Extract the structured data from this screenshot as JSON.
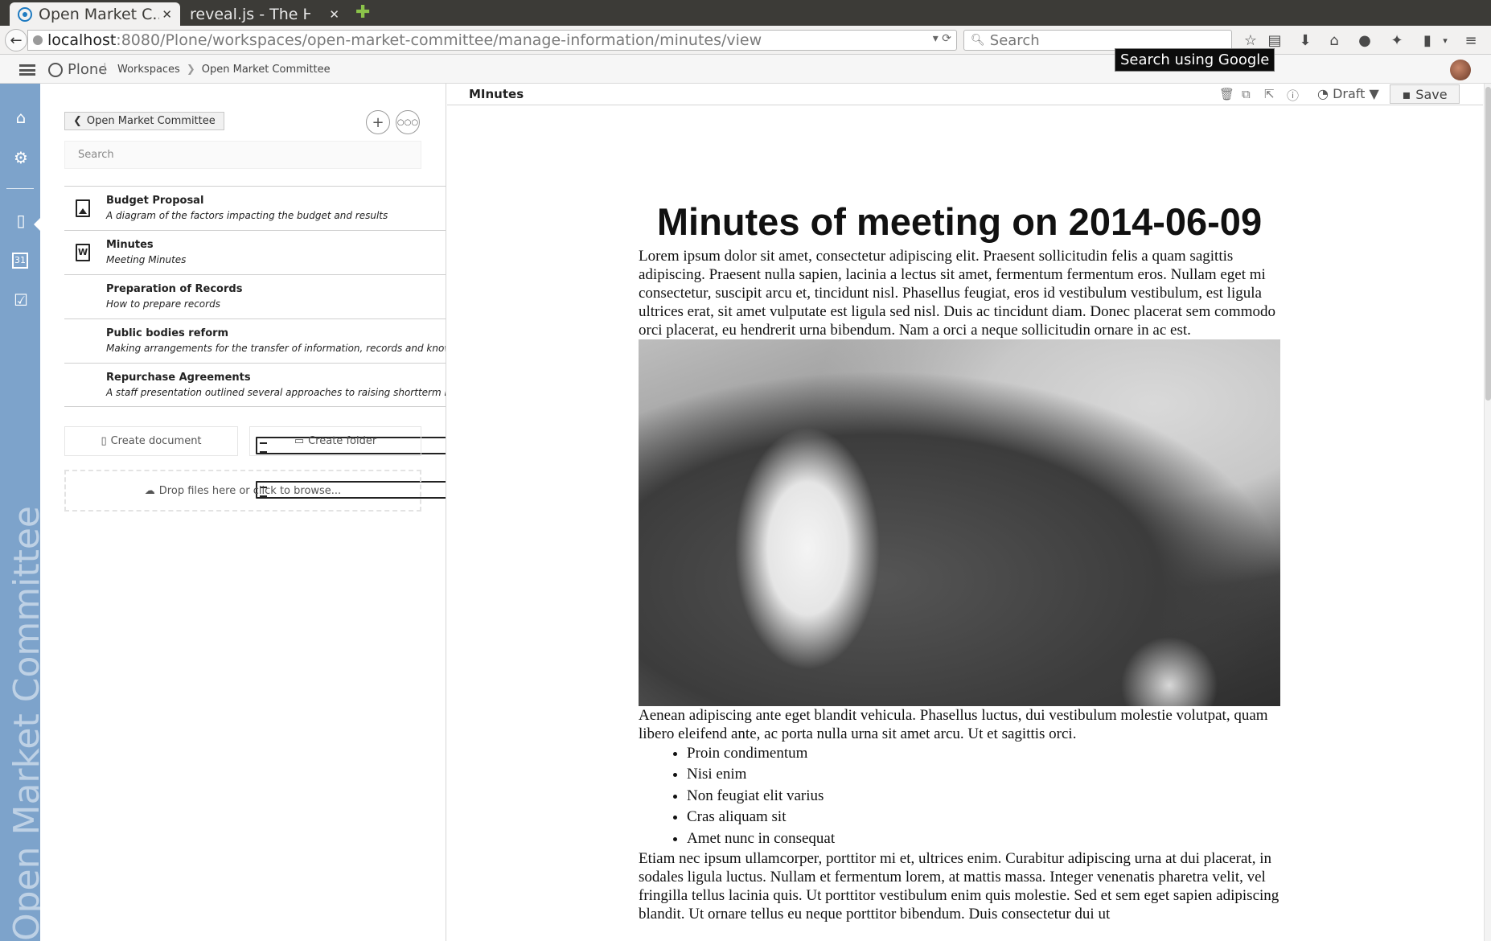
{
  "browser": {
    "tabs": [
      {
        "title": "Open Market C...",
        "active": true
      },
      {
        "title": "reveal.js - The HTM...",
        "active": false
      }
    ],
    "url_host": "localhost",
    "url_path": ":8080/Plone/workspaces/open-market-committee/manage-information/minutes/view",
    "search_placeholder": "Search",
    "tooltip": "Search using Google"
  },
  "toolbar": {
    "logo": "Plone",
    "breadcrumbs": [
      "Workspaces",
      "Open Market Committee"
    ]
  },
  "leftbar": {
    "workspace_title": "Open Market Committee",
    "calendar_day": "31"
  },
  "sidebar": {
    "back_label": "Open Market Committee",
    "search_placeholder": "Search",
    "items": [
      {
        "title": "Budget Proposal",
        "description": "A diagram of the factors impacting the budget and results",
        "icon": "image-file-icon"
      },
      {
        "title": "Minutes",
        "description": "Meeting Minutes",
        "icon": "word-file-icon"
      },
      {
        "title": "Preparation of Records",
        "description": "How to prepare records",
        "icon": ""
      },
      {
        "title": "Public bodies reform",
        "description": "Making arrangements for the transfer of information, records and knowledge",
        "icon": "document-icon"
      },
      {
        "title": "Repurchase Agreements",
        "description": "A staff presentation outlined several approaches to raising shortterm interest rates",
        "icon": "document-icon"
      }
    ],
    "create_document": "Create document",
    "create_folder": "Create folder",
    "dropzone": "Drop files here or click to browse..."
  },
  "main": {
    "title": "MInutes",
    "state": "Draft",
    "save_label": "Save",
    "document": {
      "heading": "Minutes of meeting on 2014-06-09",
      "paragraph1": "Lorem ipsum dolor sit amet, consectetur adipiscing elit. Praesent sollicitudin felis a quam sagittis adipiscing. Praesent nulla sapien, lacinia a lectus sit amet, fermentum fermentum eros. Nullam eget mi consectetur, suscipit arcu et, tincidunt nisl. Phasellus feugiat, eros id vestibulum vestibulum, est ligula ultrices erat, sit amet vulputate est ligula sed nisl. Duis ac tincidunt diam. Donec placerat sem commodo orci placerat, eu hendrerit urna bibendum. Nam a orci a neque sollicitudin ornare in ac est.",
      "paragraph2": "Aenean adipiscing ante eget blandit vehicula. Phasellus luctus, dui vestibulum molestie volutpat, quam libero eleifend ante, ac porta nulla urna sit amet arcu. Ut et sagittis orci.",
      "bullets": [
        "Proin condimentum",
        "Nisi enim",
        "Non feugiat elit varius",
        "Cras aliquam sit",
        "Amet nunc in consequat"
      ],
      "paragraph3": "Etiam nec ipsum ullamcorper, porttitor mi et, ultrices enim. Curabitur adipiscing urna at dui placerat, in sodales ligula luctus. Nullam et fermentum lorem, at mattis massa. Integer venenatis pharetra velit, vel fringilla tellus lacinia quis. Ut porttitor vestibulum enim quis molestie. Sed et sem eget sapien adipiscing blandit. Ut ornare tellus eu neque porttitor bibendum. Duis consectetur dui ut"
    }
  }
}
